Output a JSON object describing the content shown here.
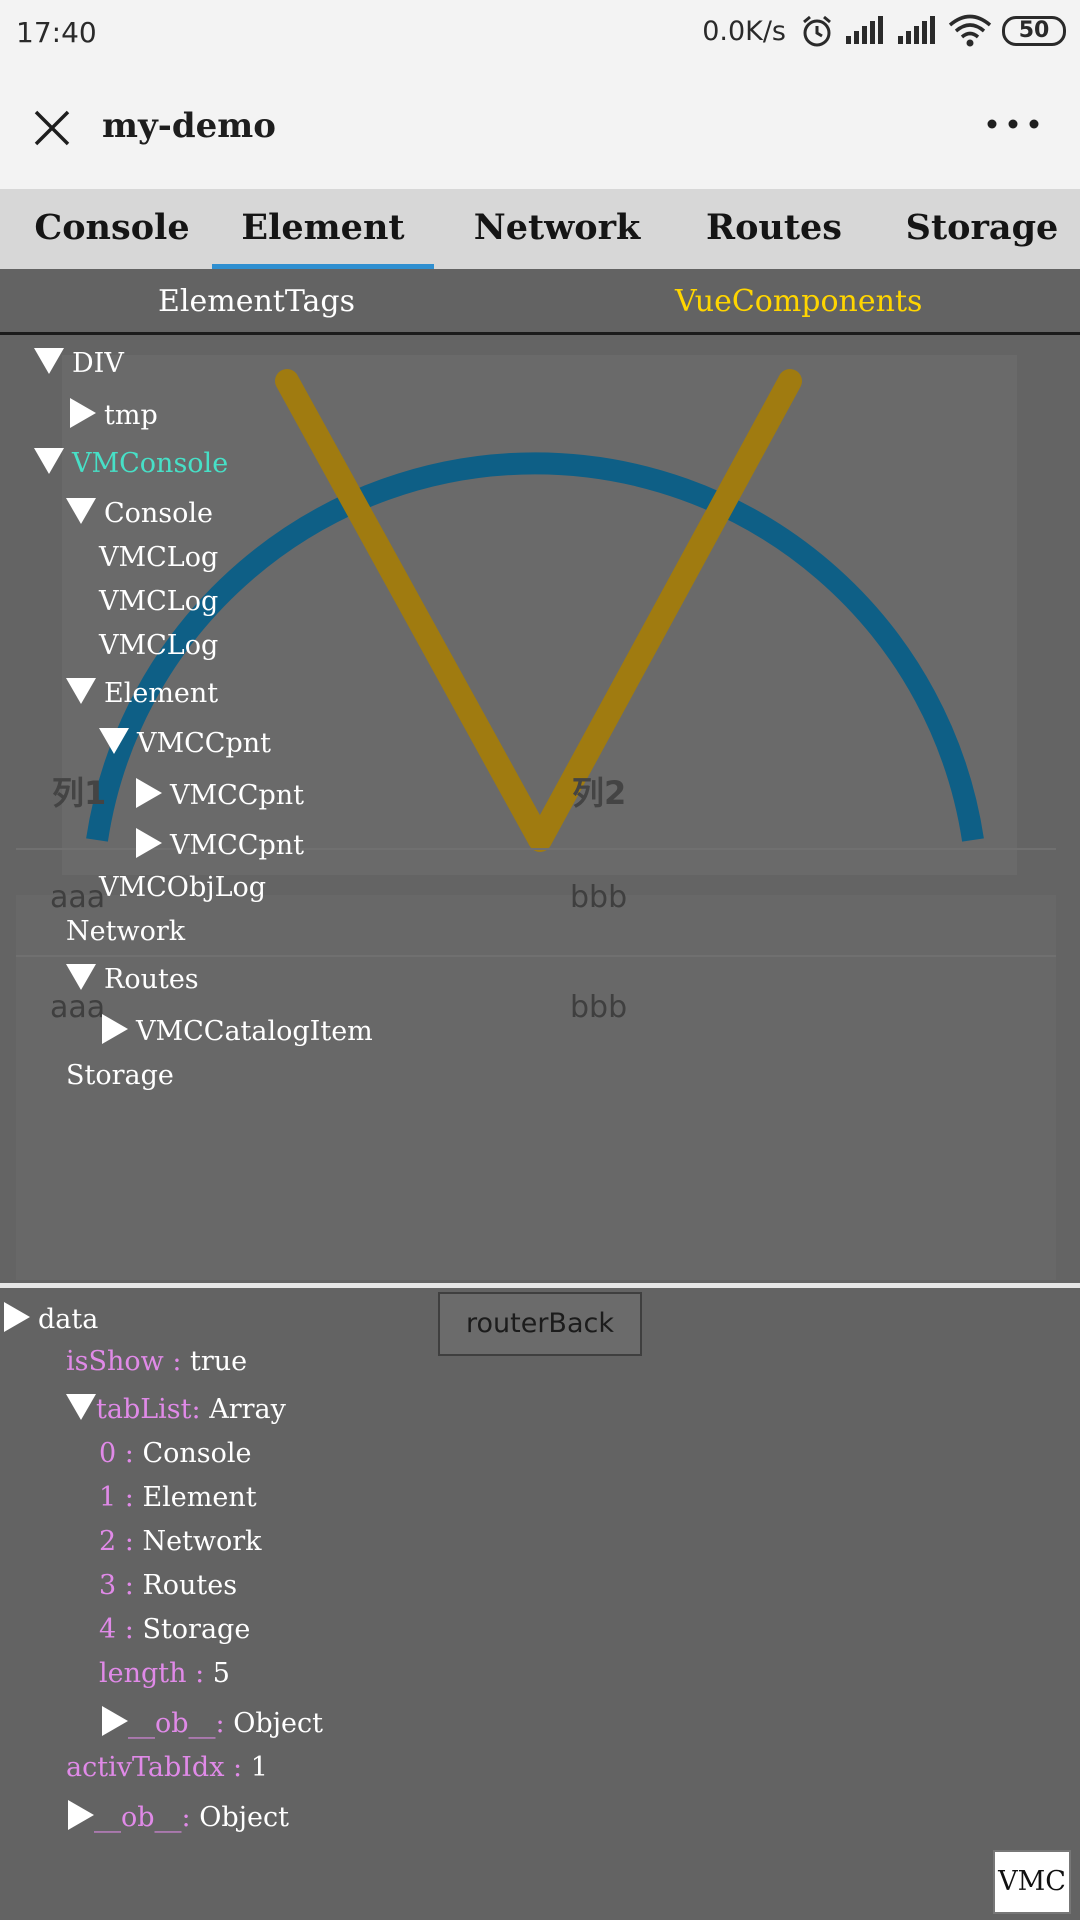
{
  "status_bar": {
    "time": "17:40",
    "net_speed": "0.0K/s",
    "battery": "50"
  },
  "title_bar": {
    "title": "my-demo"
  },
  "main_tabs": [
    {
      "label": "Console",
      "active": false
    },
    {
      "label": "Element",
      "active": true
    },
    {
      "label": "Network",
      "active": false
    },
    {
      "label": "Routes",
      "active": false
    },
    {
      "label": "Storage",
      "active": false
    }
  ],
  "sub_tabs": {
    "element_tags": "ElementTags",
    "vue_components": "VueComponents",
    "active": "VueComponents"
  },
  "tree": [
    {
      "label": "DIV",
      "toggle": "expanded"
    },
    {
      "label": "tmp",
      "toggle": "collapsed"
    },
    {
      "label": "VMConsole",
      "toggle": "expanded",
      "highlighted": true
    },
    {
      "label": "Console",
      "toggle": "expanded"
    },
    {
      "label": "VMCLog",
      "toggle": "none"
    },
    {
      "label": "VMCLog",
      "toggle": "none"
    },
    {
      "label": "VMCLog",
      "toggle": "none"
    },
    {
      "label": "Element",
      "toggle": "expanded"
    },
    {
      "label": "VMCCpnt",
      "toggle": "expanded"
    },
    {
      "label": "VMCCpnt",
      "toggle": "collapsed"
    },
    {
      "label": "VMCCpnt",
      "toggle": "collapsed"
    },
    {
      "label": "VMCObjLog",
      "toggle": "none"
    },
    {
      "label": "Network",
      "toggle": "none"
    },
    {
      "label": "Routes",
      "toggle": "expanded"
    },
    {
      "label": "VMCCatalogItem",
      "toggle": "collapsed"
    },
    {
      "label": "Storage",
      "toggle": "none"
    }
  ],
  "page_table": {
    "headers": [
      "列1",
      "列2"
    ],
    "rows": [
      [
        "aaa",
        "bbb"
      ],
      [
        "aaa",
        "bbb"
      ]
    ]
  },
  "inspector": {
    "root": "data",
    "is_show_key": "isShow",
    "is_show_value": "true",
    "tab_list_key": "tabList",
    "tab_list_type": "Array",
    "tab_list": [
      {
        "index": "0",
        "value": "Console"
      },
      {
        "index": "1",
        "value": "Element"
      },
      {
        "index": "2",
        "value": "Network"
      },
      {
        "index": "3",
        "value": "Routes"
      },
      {
        "index": "4",
        "value": "Storage"
      }
    ],
    "length_key": "length",
    "length_value": "5",
    "ob_key": "__ob__",
    "ob_type": "Object",
    "activ_tab_idx_key": "activTabIdx",
    "activ_tab_idx_value": "1",
    "root_ob_key": "__ob__",
    "root_ob_type": "Object"
  },
  "buttons": {
    "router_back": "routerBack",
    "vmc": "VMC"
  },
  "colors": {
    "tab_underline": "#2f8fd0",
    "active_subtab": "#ffd500",
    "highlight": "#47e0c7",
    "key": "#e08ae8",
    "arc": "#0e5f86",
    "lines": "#a07b10"
  }
}
